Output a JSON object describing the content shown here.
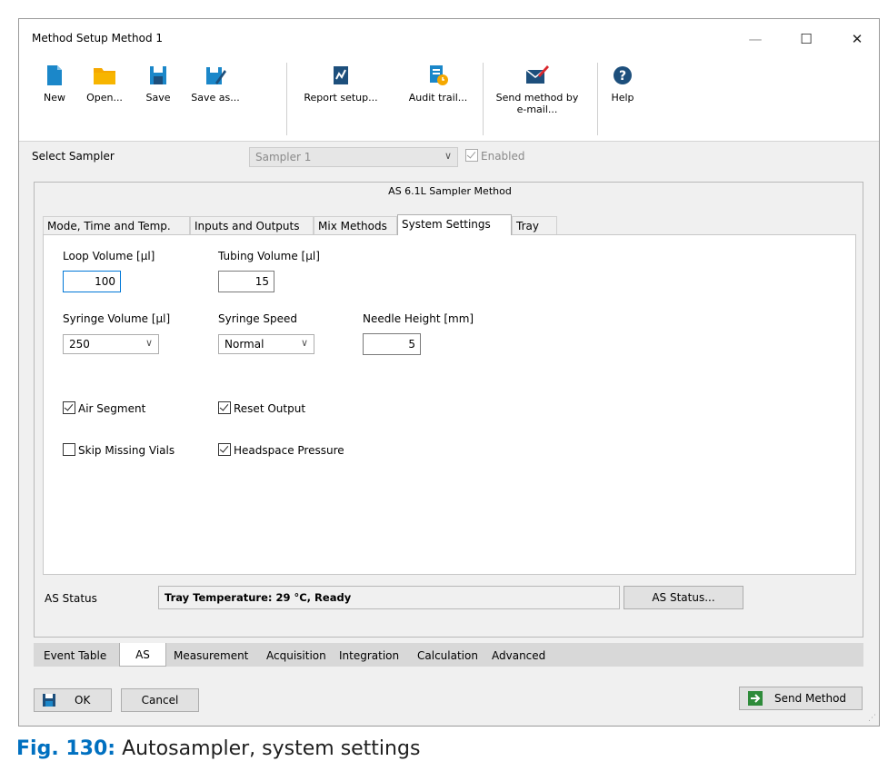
{
  "window": {
    "title": "Method Setup Method 1",
    "controls": {
      "minimize": "—",
      "maximize": "☐",
      "close": "✕"
    }
  },
  "toolbar": {
    "new": "New",
    "open": "Open...",
    "save": "Save",
    "save_as": "Save as...",
    "report_setup": "Report setup...",
    "audit_trail": "Audit trail...",
    "send_method_line1": "Send method by",
    "send_method_line2": "e-mail...",
    "help": "Help"
  },
  "sampler": {
    "label": "Select Sampler",
    "value": "Sampler 1",
    "enabled_label": "Enabled",
    "enabled_checked": true
  },
  "group_title": "AS 6.1L Sampler Method",
  "tabs": [
    "Mode, Time and Temp.",
    "Inputs and Outputs",
    "Mix Methods",
    "System Settings",
    "Tray"
  ],
  "active_tab": "System Settings",
  "settings": {
    "loop_volume_label": "Loop Volume [µl]",
    "loop_volume": "100",
    "tubing_volume_label": "Tubing Volume [µl]",
    "tubing_volume": "15",
    "syringe_volume_label": "Syringe Volume [µl]",
    "syringe_volume": "250",
    "syringe_speed_label": "Syringe Speed",
    "syringe_speed": "Normal",
    "needle_height_label": "Needle Height [mm]",
    "needle_height": "5",
    "air_segment_label": "Air Segment",
    "air_segment_checked": true,
    "reset_output_label": "Reset Output",
    "reset_output_checked": true,
    "skip_missing_label": "Skip Missing Vials",
    "skip_missing_checked": false,
    "headspace_label": "Headspace Pressure",
    "headspace_checked": true
  },
  "status": {
    "label": "AS Status",
    "text": "Tray Temperature: 29 °C, Ready",
    "button": "AS Status..."
  },
  "bottom_tabs": [
    "Event Table",
    "AS",
    "Measurement",
    "Acquisition",
    "Integration",
    "Calculation",
    "Advanced"
  ],
  "active_bottom_tab": "AS",
  "footer": {
    "ok": "OK",
    "cancel": "Cancel",
    "send_method": "Send Method"
  },
  "caption": {
    "fig_label": "Fig. 130:",
    "text": "Autosampler, system settings"
  },
  "colors": {
    "icon_blue": "#1b87c9",
    "icon_folder": "#f5a800",
    "icon_navy": "#1d4f7c",
    "caption_blue": "#0070c0",
    "send_green": "#2e8b3a"
  }
}
